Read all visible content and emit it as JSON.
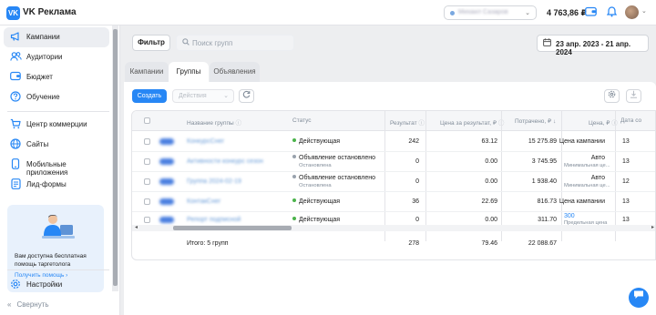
{
  "header": {
    "logo_letter": "VK",
    "app_title": "VK Реклама",
    "account_name": "Михаил Сазаров",
    "balance": "4 763,86 ₽"
  },
  "sidebar": {
    "items": [
      {
        "label": "Кампании",
        "icon": "megaphone-icon"
      },
      {
        "label": "Аудитории",
        "icon": "users-icon"
      },
      {
        "label": "Бюджет",
        "icon": "wallet-icon"
      },
      {
        "label": "Обучение",
        "icon": "question-icon"
      },
      {
        "label": "Центр коммерции",
        "icon": "cart-icon"
      },
      {
        "label": "Сайты",
        "icon": "globe-icon"
      },
      {
        "label": "Мобильные приложения",
        "icon": "phone-icon"
      },
      {
        "label": "Лид-формы",
        "icon": "form-icon"
      },
      {
        "label": "Настройки",
        "icon": "gear-icon"
      }
    ],
    "promo_text": "Вам доступна бесплатная помощь таргетолога",
    "promo_link": "Получить помощь ›",
    "collapse_label": "Свернуть"
  },
  "toolbar": {
    "filter_label": "Фильтр",
    "search_placeholder": "Поиск групп",
    "date_range": "23 апр. 2023 - 21 апр. 2024"
  },
  "tabs": [
    "Кампании",
    "Группы",
    "Объявления"
  ],
  "actions": {
    "create_label": "Создать",
    "action_placeholder": "Действия"
  },
  "table": {
    "headers": {
      "name": "Название группы",
      "status": "Статус",
      "result": "Результат",
      "cost_per_result": "Цена за результат, ₽",
      "spent": "Потрачено, ₽ ↓",
      "price": "Цена, ₽",
      "date": "Дата со"
    },
    "rows": [
      {
        "name": "КонкурсСнег",
        "status": "Действующая",
        "status_sub": "",
        "status_color": "#4bb34b",
        "result": "242",
        "cpr": "63.12",
        "spent": "15 275.89",
        "price": "Цена кампании",
        "price_sub": "",
        "date": "13"
      },
      {
        "name": "Активности конкурс сезон",
        "status": "Объявление остановлено",
        "status_sub": "Остановлена",
        "status_color": "#99a2ad",
        "result": "0",
        "cpr": "0.00",
        "spent": "3 745.95",
        "price": "Авто",
        "price_sub": "Минимальная це...",
        "date": "13"
      },
      {
        "name": "Группа 2024-02-19",
        "status": "Объявление остановлено",
        "status_sub": "Остановлена",
        "status_color": "#99a2ad",
        "result": "0",
        "cpr": "0.00",
        "spent": "1 938.40",
        "price": "Авто",
        "price_sub": "Минимальная це...",
        "date": "12"
      },
      {
        "name": "КонтакСнег",
        "status": "Действующая",
        "status_sub": "",
        "status_color": "#4bb34b",
        "result": "36",
        "cpr": "22.69",
        "spent": "816.73",
        "price": "Цена кампании",
        "price_sub": "",
        "date": "13"
      },
      {
        "name": "Репорт подписной",
        "status": "Действующая",
        "status_sub": "",
        "status_color": "#4bb34b",
        "result": "0",
        "cpr": "0.00",
        "spent": "311.70",
        "price": "300",
        "price_sub": "Предельная цена",
        "date": "13"
      }
    ],
    "footer": {
      "label": "Итого: 5 групп",
      "result": "278",
      "cpr": "79.46",
      "spent": "22 088.67"
    }
  },
  "colors": {
    "accent": "#2787f5",
    "active_status": "#4bb34b",
    "stopped_status": "#99a2ad"
  }
}
